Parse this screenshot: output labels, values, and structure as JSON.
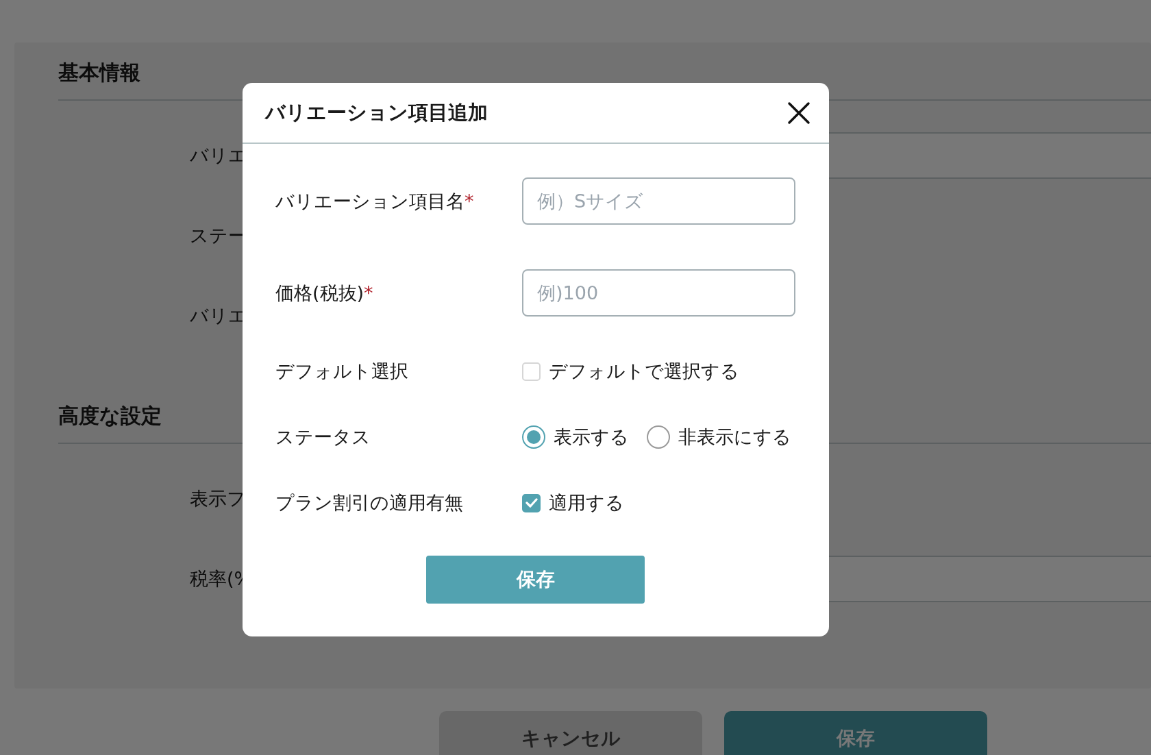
{
  "page": {
    "sections": [
      {
        "title": "基本情報",
        "rows": [
          {
            "label": "バリエ",
            "kind": "input"
          },
          {
            "label": "ステー",
            "kind": "label"
          },
          {
            "label": "バリエ",
            "kind": "label"
          }
        ]
      },
      {
        "title": "高度な設定",
        "rows": [
          {
            "label": "表示フ",
            "kind": "label"
          },
          {
            "label": "税率(%",
            "kind": "input"
          }
        ]
      }
    ],
    "buttons": [
      {
        "label": "キャンセル",
        "kind": "secondary"
      },
      {
        "label": "保存",
        "kind": "primary"
      }
    ]
  },
  "dialog": {
    "title": "バリエーション項目追加",
    "fields": [
      {
        "kind": "text",
        "label": "バリエーション項目名",
        "required_mark": "*",
        "placeholder": "例）Sサイズ"
      },
      {
        "kind": "text",
        "label": "価格(税抜)",
        "required_mark": "*",
        "placeholder": "例)100"
      },
      {
        "kind": "checkbox",
        "label": "デフォルト選択",
        "option": "デフォルトで選択する",
        "checked": false
      },
      {
        "kind": "radio",
        "label": "ステータス",
        "options": [
          {
            "label": "表示する",
            "selected": true
          },
          {
            "label": "非表示にする",
            "selected": false
          }
        ]
      },
      {
        "kind": "checkbox",
        "label": "プラン割引の適用有無",
        "option": "適用する",
        "checked": true
      }
    ],
    "submit": "保存"
  }
}
